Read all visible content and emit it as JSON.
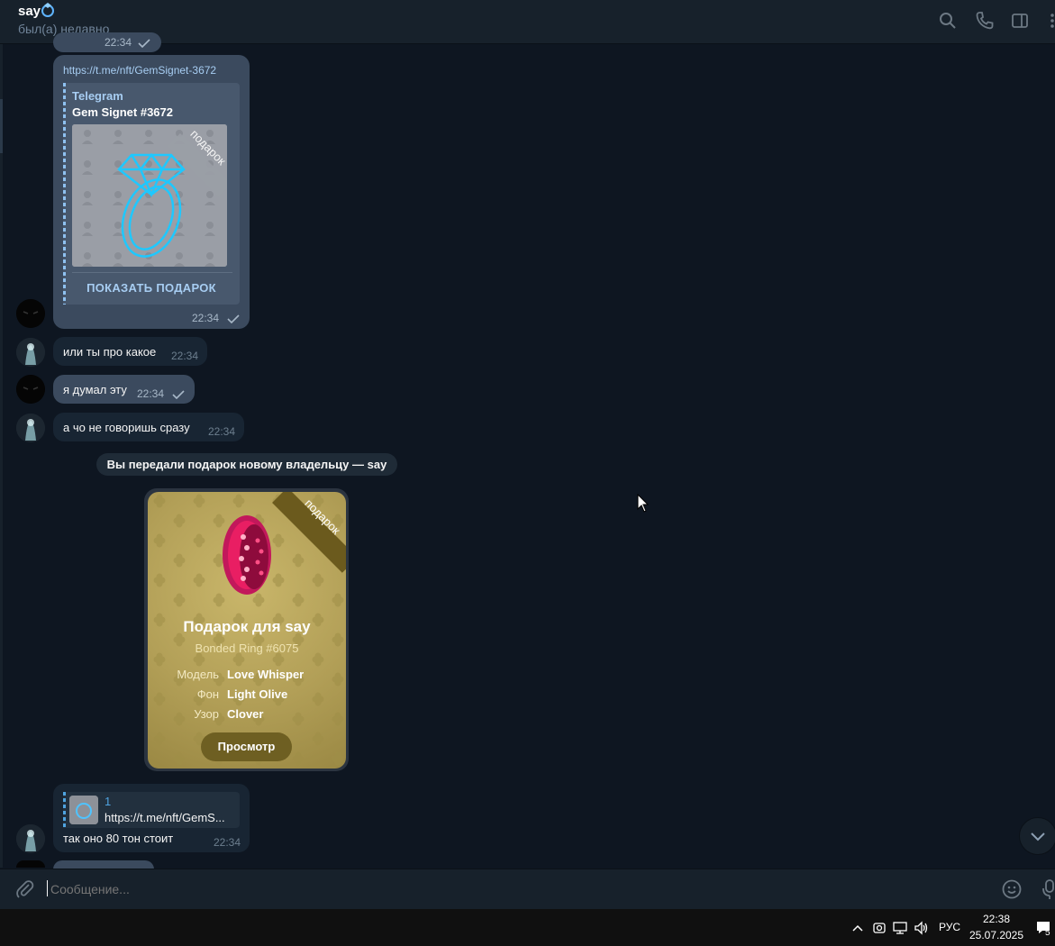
{
  "header": {
    "title": "say",
    "status": "был(а) недавно",
    "icons": [
      "search-icon",
      "phone-icon",
      "sidebar-toggle-icon",
      "more-icon"
    ]
  },
  "messages": {
    "top_partial_time": "22:34",
    "link_msg": {
      "url": "https://t.me/nft/GemSignet-3672",
      "site": "Telegram",
      "title": "Gem Signet #3672",
      "ribbon": "подарок",
      "action": "ПОКАЗАТЬ ПОДАРОК",
      "time": "22:34"
    },
    "msg1": {
      "text": "или ты про какое",
      "time": "22:34"
    },
    "msg2": {
      "text": "я думал эту",
      "time": "22:34"
    },
    "msg3": {
      "text": "а чо не говоришь сразу",
      "time": "22:34"
    },
    "service": "Вы передали подарок новому владельцу — say",
    "gift": {
      "ribbon": "подарок",
      "title": "Подарок для say",
      "subtitle": "Bonded Ring #6075",
      "attributes": [
        {
          "key": "Модель",
          "value": "Love Whisper"
        },
        {
          "key": "Фон",
          "value": "Light Olive"
        },
        {
          "key": "Узор",
          "value": "Clover"
        }
      ],
      "button": "Просмотр",
      "background_color": "#b29f57"
    },
    "reply_msg": {
      "reply_name": "1",
      "reply_link": "https://t.me/nft/GemS...",
      "text": "так оно 80 тон стоит",
      "time": "22:34"
    }
  },
  "composer": {
    "placeholder": "Сообщение..."
  },
  "taskbar": {
    "lang": "РУС",
    "time": "22:38",
    "date": "25.07.2025",
    "notifications": "5"
  },
  "colors": {
    "background": "#0e1621",
    "panel": "#17212b",
    "incoming_bubble": "#182533",
    "outgoing_bubble": "#2b5278",
    "link_accent": "#a7cdf2"
  }
}
